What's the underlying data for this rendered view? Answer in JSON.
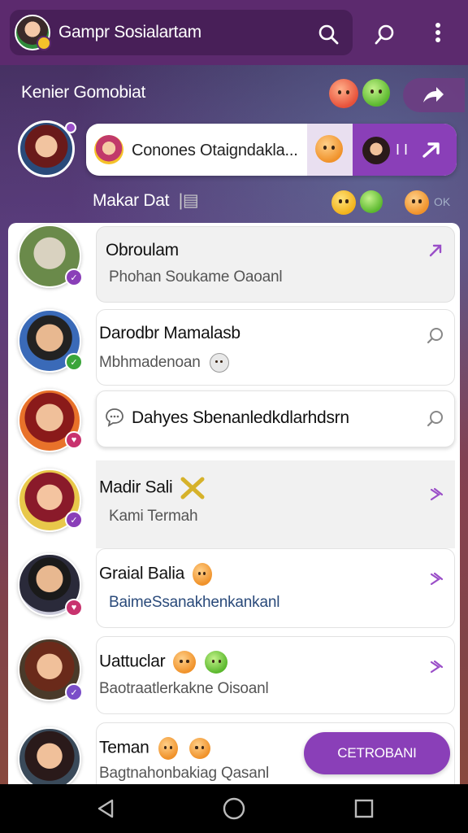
{
  "header": {
    "title": "Gampr Sosialartam",
    "search_icon": "search-icon",
    "chat_search_icon": "chat-search-icon",
    "menu_icon": "more-vert-icon"
  },
  "section": {
    "title": "Kenier Gomobiat",
    "subtitle": "Makar Dat",
    "ok_label": "OK"
  },
  "story": {
    "text": "Conones Otaigndakla...",
    "action_label": "I I"
  },
  "chats": [
    {
      "name": "Obroulam",
      "preview": "Phohan Soukame  Oaoanl",
      "badge_color": "#8a3fb8",
      "chevron": "arrow-icon"
    },
    {
      "name": "Darodbr Mamalasb",
      "preview": "Mbhmadenoan",
      "badge_color": "#3aa53a",
      "chevron": "search-chat-icon"
    },
    {
      "name": "Dahyes Sbenanledkdlarhdsrn",
      "preview": "",
      "badge_color": "#c8336e",
      "chevron": "search-chat-icon"
    },
    {
      "name": "Madir Sali",
      "preview": "Kami Termah",
      "badge_color": "#8a3fb8",
      "chevron": "chevron-right-icon"
    },
    {
      "name": "Graial Balia",
      "preview": "BaimeSsanakhenkankanl",
      "badge_color": "#c8336e",
      "chevron": "chevron-right-icon"
    },
    {
      "name": "Uattuclar",
      "preview": "Baotraatlerkakne  Oisoanl",
      "badge_color": "#7a4ec8",
      "chevron": "chevron-right-icon"
    },
    {
      "name": "Teman",
      "preview": "Bagtnahonbakiag  Qasanl",
      "badge_color": "#3a7ad8",
      "chevron": ""
    }
  ],
  "cta": {
    "label": "CETROBANI"
  },
  "nav": {
    "back": "back-icon",
    "home": "home-icon",
    "recents": "recents-icon"
  },
  "colors": {
    "accent": "#8a3fb8",
    "topbar": "#5c2a6e"
  }
}
